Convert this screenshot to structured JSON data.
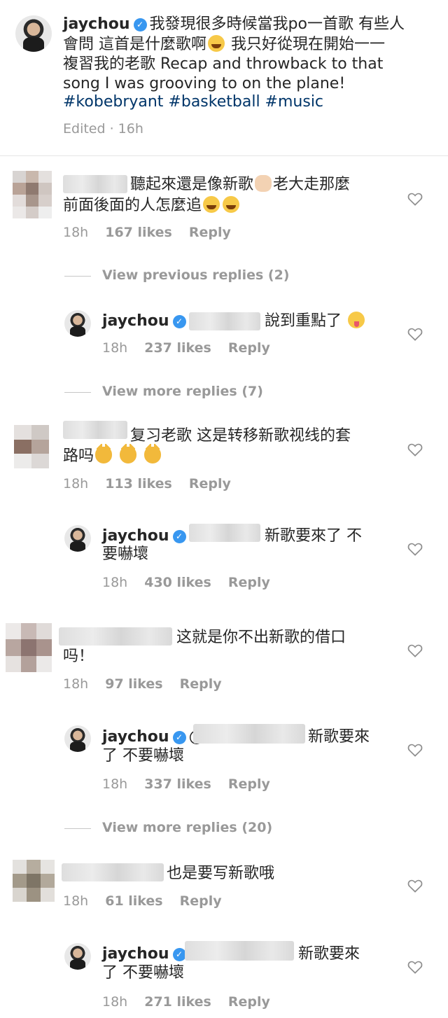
{
  "caption": {
    "username": "jaychou",
    "line1": "我發現很多時候當我po一首歌 有些人",
    "line2_a": "會問 這首是什麼歌啊",
    "line2_b": " 我只好從現在開始一一",
    "line3": "複習我的老歌 Recap and throwback to that",
    "line4": "song I was grooving to on the plane!",
    "hashtags": "#kobebryant #basketball #music",
    "edited": "Edited · 16h"
  },
  "comments": [
    {
      "text1_a": "聽起來還是像新歌",
      "text1_b": "老大走那麼",
      "text2": "前面後面的人怎麼追",
      "time": "18h",
      "likes": "167 likes",
      "reply": "Reply"
    },
    {
      "text1": "复习老歌 这是转移新歌视线的套",
      "text2": "路吗",
      "time": "18h",
      "likes": "113 likes",
      "reply": "Reply"
    },
    {
      "text1": "这就是你不出新歌的借口",
      "text2": "吗！",
      "time": "18h",
      "likes": "97 likes",
      "reply": "Reply"
    },
    {
      "text1": "也是要写新歌哦",
      "time": "18h",
      "likes": "61 likes",
      "reply": "Reply"
    }
  ],
  "replies": [
    {
      "username": "jaychou",
      "text1": "說到重點了",
      "time": "18h",
      "likes": "237 likes",
      "reply": "Reply"
    },
    {
      "username": "jaychou",
      "text1": "新歌要來了 不",
      "text2": "要嚇壞",
      "time": "18h",
      "likes": "430 likes",
      "reply": "Reply"
    },
    {
      "username": "jaychou",
      "at": "@",
      "text1": "新歌要來",
      "text2": "了 不要嚇壞",
      "time": "18h",
      "likes": "337 likes",
      "reply": "Reply"
    },
    {
      "username": "jaychou",
      "text1": "新歌要來",
      "text2": "了 不要嚇壞",
      "time": "18h",
      "likes": "271 likes",
      "reply": "Reply"
    }
  ],
  "view_links": {
    "previous": "View previous replies (2)",
    "more_7": "View more replies (7)",
    "more_20": "View more replies (20)"
  },
  "colors": {
    "link": "#003569",
    "meta": "#999999",
    "verified": "#3897f0"
  }
}
